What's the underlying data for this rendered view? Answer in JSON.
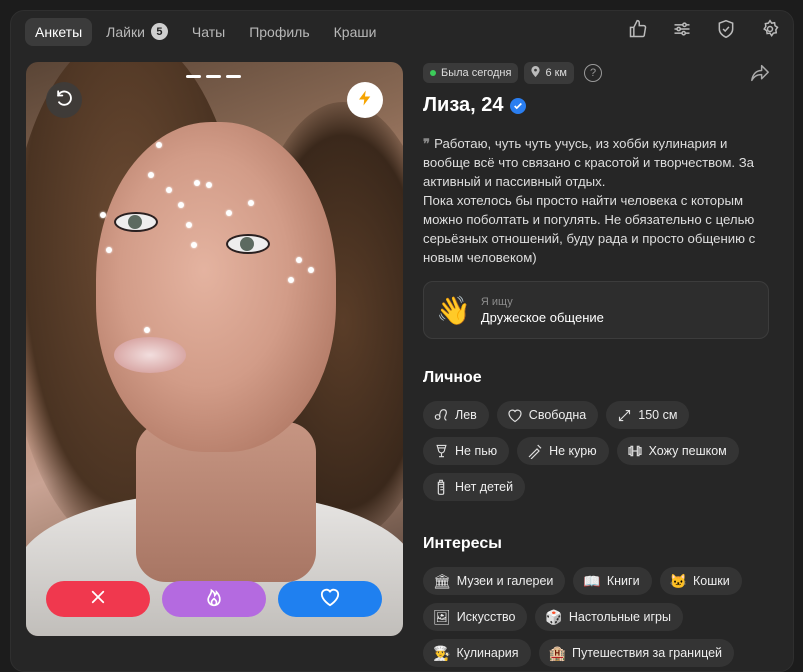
{
  "nav": {
    "tabs": [
      {
        "label": "Анкеты",
        "active": true
      },
      {
        "label": "Лайки",
        "badge": "5"
      },
      {
        "label": "Чаты"
      },
      {
        "label": "Профиль"
      },
      {
        "label": "Краши"
      }
    ],
    "icons": [
      "thumbs-up-icon",
      "sliders-icon",
      "shield-icon",
      "gear-icon"
    ]
  },
  "profile": {
    "status": "Была сегодня",
    "distance": "6 км",
    "help": "?",
    "name": "Лиза, 24",
    "bio": "Работаю, чуть чуть учусь, из хобби кулинария и вообще всё что связано с красотой и творчеством. За активный и пассивный отдых.\nПока хотелось бы просто найти человека с которым можно поболтать и погулять. Не обязательно с целью серьёзных отношений, буду рада и просто общению с новым человеком)",
    "seeking": {
      "label": "Я ищу",
      "value": "Дружеское общение"
    }
  },
  "personal": {
    "title": "Личное",
    "items": [
      {
        "label": "Лев",
        "icon": "leo-icon"
      },
      {
        "label": "Свободна",
        "icon": "heart-outline-icon"
      },
      {
        "label": "150 см",
        "icon": "expand-arrows-icon"
      },
      {
        "label": "Не пью",
        "icon": "wine-glass-icon"
      },
      {
        "label": "Не курю",
        "icon": "no-smoking-icon"
      },
      {
        "label": "Хожу пешком",
        "icon": "dumbbell-icon"
      },
      {
        "label": "Нет детей",
        "icon": "baby-bottle-icon"
      }
    ]
  },
  "interests": {
    "title": "Интересы",
    "items": [
      {
        "label": "Музеи и галереи",
        "emoji": "🏛"
      },
      {
        "label": "Книги",
        "emoji": "📖"
      },
      {
        "label": "Кошки",
        "emoji": "🐱"
      },
      {
        "label": "Искусство",
        "emoji": "🖼"
      },
      {
        "label": "Настольные игры",
        "emoji": "🎲"
      },
      {
        "label": "Кулинария",
        "emoji": "👨‍🍳"
      },
      {
        "label": "Путешествия за границей",
        "emoji": "🏨"
      }
    ]
  },
  "colors": {
    "dislike": "#f0384e",
    "superlike": "#b46ae0",
    "like": "#1f80f0",
    "online": "#3ccb5a"
  }
}
